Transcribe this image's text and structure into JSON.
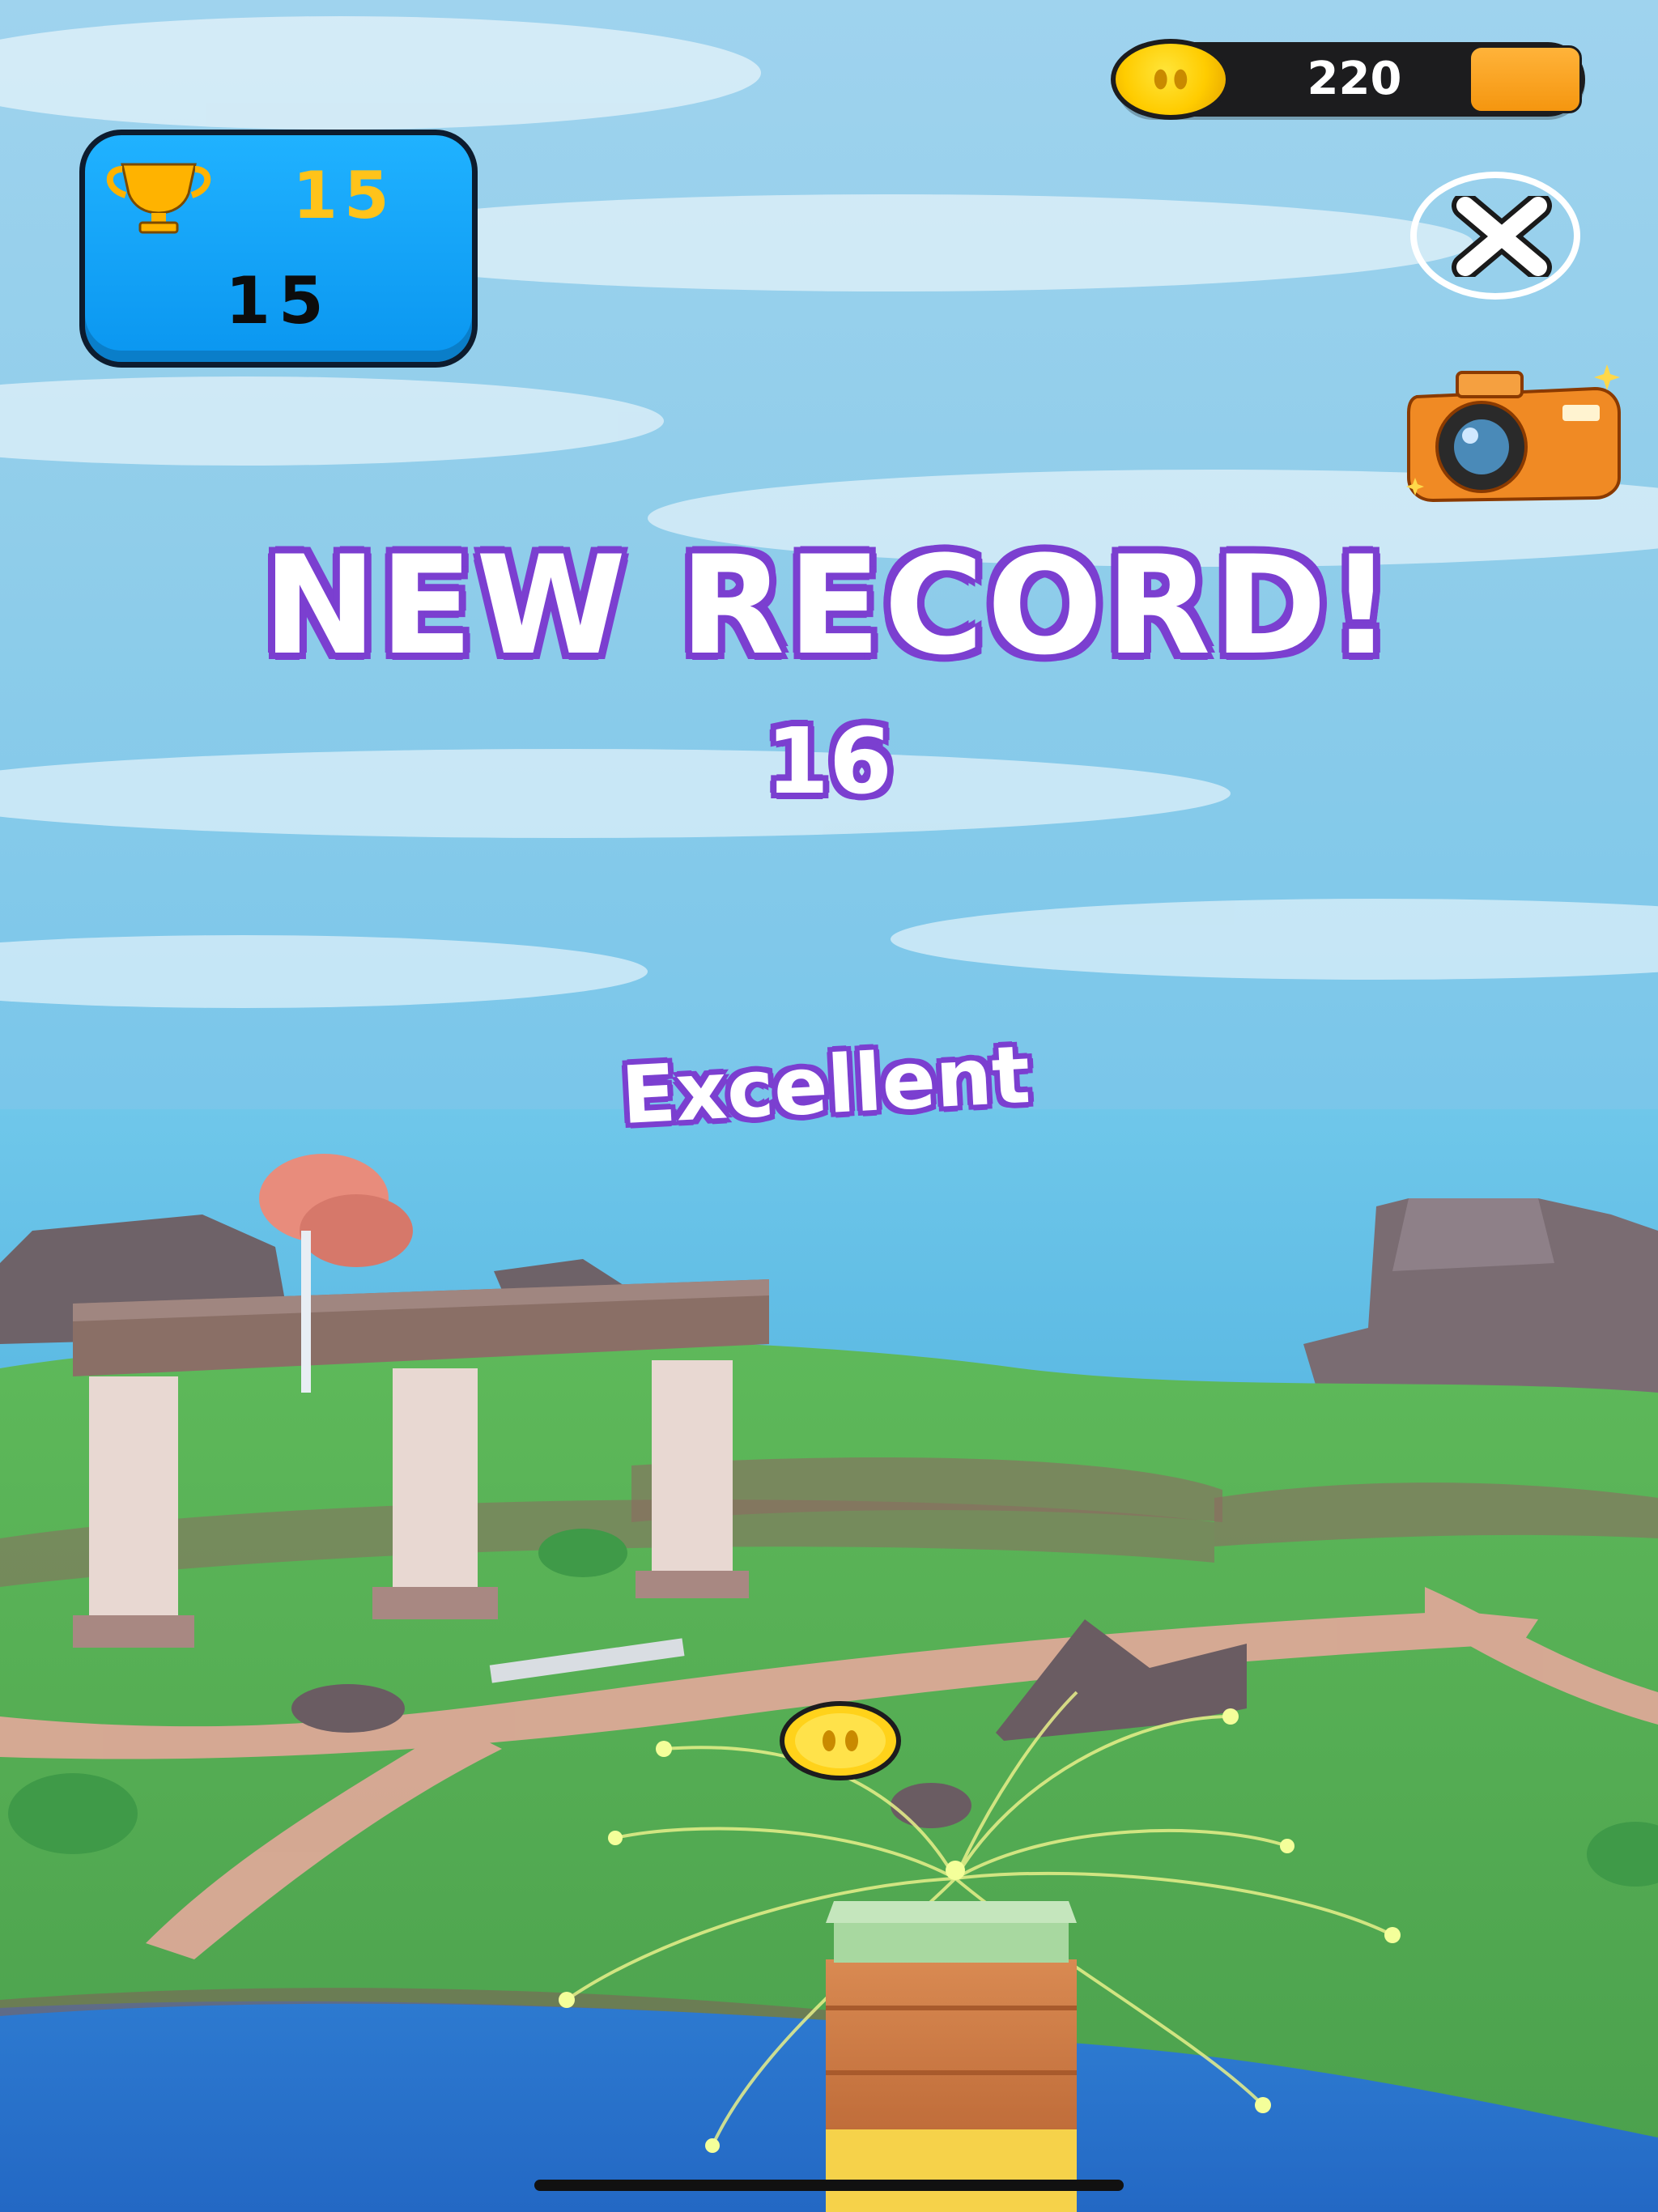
{
  "hud": {
    "coins": "220",
    "best_score": "15",
    "current_score": "15"
  },
  "headline": "NEW RECORD!",
  "record_score": "16",
  "praise": "Excellent",
  "icons": {
    "coin": "coin-icon",
    "add": "add-coins-button",
    "trophy": "trophy-icon",
    "close": "close-icon",
    "camera": "camera-icon"
  },
  "colors": {
    "outline_purple": "#7b3fd0",
    "panel_blue": "#0a96f0",
    "trophy_gold": "#ffc31a",
    "coin_yellow": "#ffcc00",
    "add_orange": "#f5960f"
  }
}
